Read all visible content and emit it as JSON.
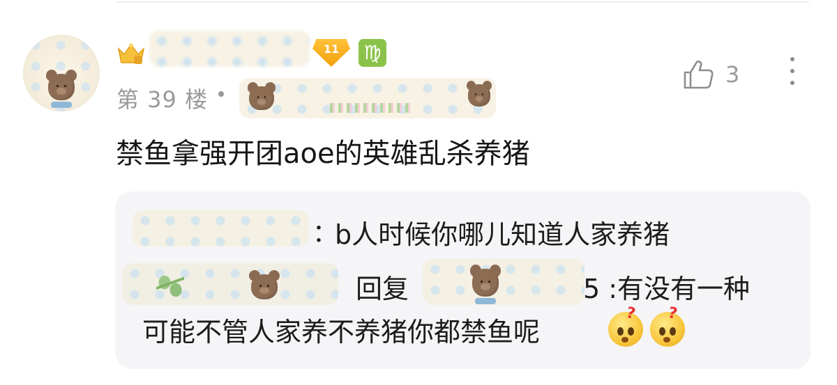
{
  "comment": {
    "level": "11",
    "zodiac_symbol": "♍",
    "floor": "第 39 楼",
    "separator": "•",
    "content": "禁鱼拿强开团aoe的英雄乱杀养猪",
    "likes": "3",
    "colors": {
      "level_badge": "#f5a623",
      "zodiac_badge": "#8bc34a",
      "reply_box": "#f5f5f7",
      "muted_text": "#9a9a9a"
    }
  },
  "replies": [
    {
      "colon": "：",
      "text": "b人时候你哪儿知道人家养猪"
    },
    {
      "verb": "回复",
      "head": "5 :有没有一种",
      "body": "可能不管人家养不养猪你都禁鱼呢",
      "emojis": [
        "thinking-face",
        "thinking-face"
      ]
    }
  ],
  "icons": [
    "crown-icon",
    "diamond-level-icon",
    "virgo-icon",
    "thumbs-up-icon",
    "more-vertical-icon"
  ]
}
